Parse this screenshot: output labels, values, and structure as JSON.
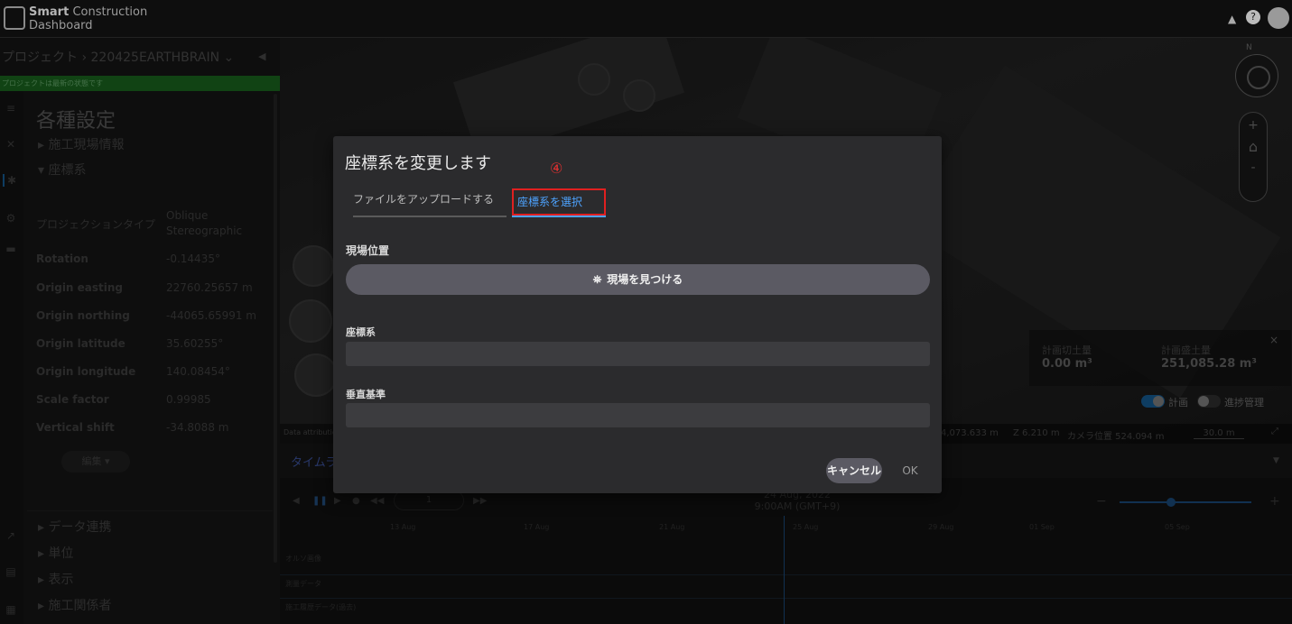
{
  "app": {
    "title_bold": "Smart",
    "title_rest": "Construction",
    "title_line2": "Dashboard"
  },
  "topbar": {
    "bell_icon": "bell-icon",
    "help_icon": "help-icon",
    "avatar": "avatar"
  },
  "sidebar": {
    "breadcrumb": "プロジェクト › 220425EARTHBRAIN ⌄",
    "status": "プロジェクトは最新の状態です",
    "section_title": "各種設定",
    "tree_top": [
      "▸  施工現場情報",
      "▾  座標系"
    ],
    "properties": [
      {
        "label": "プロジェクションタイプ",
        "value": "Oblique Stereographic"
      },
      {
        "label": "Rotation",
        "value": "-0.14435°"
      },
      {
        "label": "Origin easting",
        "value": "22760.25657 m"
      },
      {
        "label": "Origin northing",
        "value": "-44065.65991 m"
      },
      {
        "label": "Origin latitude",
        "value": "35.60255°"
      },
      {
        "label": "Origin longitude",
        "value": "140.08454°"
      },
      {
        "label": "Scale factor",
        "value": "0.99985"
      },
      {
        "label": "Vertical shift",
        "value": "-34.8088 m"
      }
    ],
    "edit_label": "編集 ▾",
    "tree_bottom": [
      "▸  データ連携",
      "▸  単位",
      "▸  表示",
      "▸  施工関係者"
    ]
  },
  "map": {
    "compass_label": "N",
    "zoom": {
      "plus": "+",
      "home": "⌂",
      "minus": "-"
    },
    "volumes": {
      "cut_label": "計画切土量",
      "cut_value": "0.00 m³",
      "fill_label": "計画盛土量",
      "fill_value": "251,085.28 m³",
      "close": "×"
    },
    "toggles": {
      "plan": "計画",
      "progress": "進捗管理"
    },
    "status": {
      "attribution": "Data attribution",
      "coords": "4,073.633 m",
      "z": "Z 6.210 m",
      "camera": "カメラ位置 524.094 m",
      "scale": "30.0 m"
    }
  },
  "timeline": {
    "title": "タイムライン",
    "page": "1",
    "date": "24 Aug, 2022 9:00AM (GMT+9)",
    "ticks": [
      "13 Aug",
      "17 Aug",
      "21 Aug",
      "25 Aug",
      "29 Aug",
      "01 Sep",
      "05 Sep"
    ],
    "rows": [
      "オルソ画像",
      "測量データ",
      "施工履歴データ(過去)"
    ]
  },
  "modal": {
    "title": "座標系を変更します",
    "step_mark": "④",
    "tabs": {
      "upload": "ファイルをアップロードする",
      "select": "座標系を選択"
    },
    "site_label": "現場位置",
    "find_button": "現場を見つける",
    "crs_label": "座標系",
    "vertical_label": "垂直基準",
    "cancel": "キャンセル",
    "ok": "OK"
  }
}
